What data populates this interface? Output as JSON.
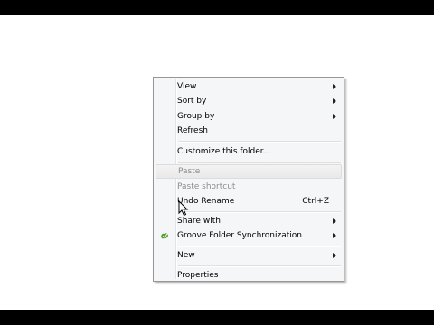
{
  "context_menu": {
    "items": [
      {
        "label": "View",
        "submenu": true
      },
      {
        "label": "Sort by",
        "submenu": true
      },
      {
        "label": "Group by",
        "submenu": true
      },
      {
        "label": "Refresh"
      },
      {
        "label": "Customize this folder..."
      },
      {
        "label": "Paste",
        "disabled": true
      },
      {
        "label": "Paste shortcut",
        "disabled": true
      },
      {
        "label": "Undo Rename",
        "shortcut": "Ctrl+Z"
      },
      {
        "label": "Share with",
        "submenu": true
      },
      {
        "label": "Groove Folder Synchronization",
        "submenu": true,
        "icon": "groove-icon"
      },
      {
        "label": "New",
        "submenu": true
      },
      {
        "label": "Properties"
      }
    ]
  },
  "colors": {
    "menu_background": "#f5f6f7",
    "disabled_text": "#8d8d8d",
    "groove_icon": "#4d9a2a"
  }
}
